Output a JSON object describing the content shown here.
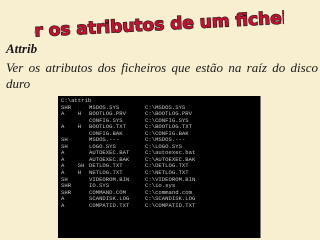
{
  "banner": {
    "title": "Ver os atributos de um ficheiro",
    "fill": "#c8102e",
    "outline": "#1a1a1a"
  },
  "section": {
    "heading": "Attrib",
    "description": "Ver os atributos dos ficheiros que estão na raíz do disco duro"
  },
  "console": {
    "prompt": "C:\\attrib",
    "rows": [
      {
        "attr": "SHR",
        "file": "MSDOS.SYS",
        "path": "C:\\MSDOS.SYS"
      },
      {
        "attr": "A    H",
        "file": "BOOTLOG.PRV",
        "path": "C:\\BOOTLOG.PRV"
      },
      {
        "attr": "",
        "file": "CONFIG.SYS",
        "path": "C:\\CONFIG.SYS"
      },
      {
        "attr": "A    H",
        "file": "BOOTLOG.TXT",
        "path": "C:\\BOOTLOG.TXT"
      },
      {
        "attr": "",
        "file": "CONFIG.BAK",
        "path": "C:\\CONFIG.BAK"
      },
      {
        "attr": "SH",
        "file": "MSDOS.---",
        "path": "C:\\MSDOS.---"
      },
      {
        "attr": "SH",
        "file": "LOGO.SYS",
        "path": "C:\\LOGO.SYS"
      },
      {
        "attr": "A",
        "file": "AUTOEXEC.BAT",
        "path": "C:\\autoexec.bat"
      },
      {
        "attr": "A",
        "file": "AUTOEXEC.BAK",
        "path": "C:\\AUTOEXEC.BAK"
      },
      {
        "attr": "A    SH",
        "file": "DETLOG.TXT",
        "path": "C:\\DETLOG.TXT"
      },
      {
        "attr": "A    H",
        "file": "NETLOG.TXT",
        "path": "C:\\NETLOG.TXT"
      },
      {
        "attr": "SH",
        "file": "VIDEOROM.BIN",
        "path": "C:\\VIDEOROM.BIN"
      },
      {
        "attr": "SHR",
        "file": "IO.SYS",
        "path": "C:\\io.sys"
      },
      {
        "attr": "SHR",
        "file": "COMMAND.COM",
        "path": "C:\\command.com"
      },
      {
        "attr": "A",
        "file": "SCANDISK.LOG",
        "path": "C:\\SCANDISK.LOG"
      },
      {
        "attr": "A",
        "file": "COMPATID.TXT",
        "path": "C:\\COMPATID.TXT"
      }
    ]
  }
}
